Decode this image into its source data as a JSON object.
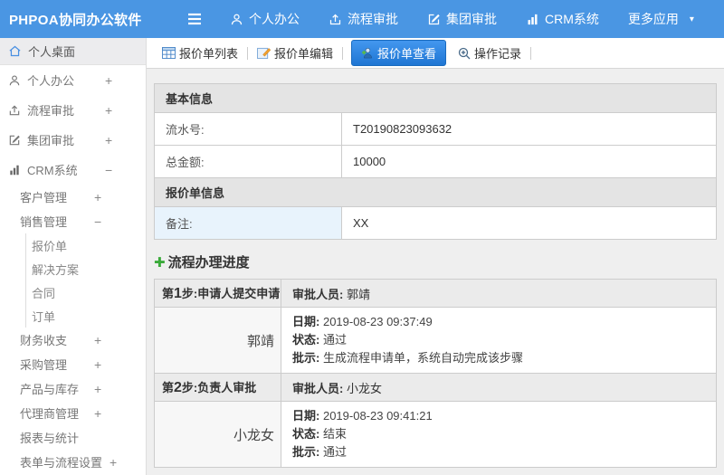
{
  "colors": {
    "navbar_blue": "#4a96e3",
    "active_tab_blue": "#2a80da",
    "page_bg": "#efefef",
    "section_header_bg": "#e4e4e4",
    "highlight_cell_bg": "#e8f3fc",
    "plus_green": "#3aaa3a"
  },
  "icons": {
    "caret_down": "▾",
    "progress_plus": "✚"
  },
  "navbar": {
    "brand": "PHPOA协同办公软件",
    "menu": [
      {
        "label": "个人办公",
        "icon": "user-icon"
      },
      {
        "label": "流程审批",
        "icon": "process-icon"
      },
      {
        "label": "集团审批",
        "icon": "edit-icon"
      },
      {
        "label": "CRM系统",
        "icon": "chart-icon"
      },
      {
        "label": "更多应用",
        "icon": "chevron-down-icon"
      }
    ]
  },
  "sidebar": {
    "items": [
      {
        "label": "个人桌面",
        "icon": "home-icon",
        "active": true
      },
      {
        "label": "个人办公",
        "icon": "user-icon",
        "expand": "+"
      },
      {
        "label": "流程审批",
        "icon": "process-icon",
        "expand": "+"
      },
      {
        "label": "集团审批",
        "icon": "edit-icon",
        "expand": "+"
      },
      {
        "label": "CRM系统",
        "icon": "chart-icon",
        "expand": "−"
      },
      {
        "label": "客户管理",
        "level": 1,
        "expand": "+"
      },
      {
        "label": "销售管理",
        "level": 1,
        "expand": "−"
      },
      {
        "label": "报价单",
        "level": 2
      },
      {
        "label": "解决方案",
        "level": 2
      },
      {
        "label": "合同",
        "level": 2
      },
      {
        "label": "订单",
        "level": 2
      },
      {
        "label": "财务收支",
        "level": 1,
        "expand": "+"
      },
      {
        "label": "采购管理",
        "level": 1,
        "expand": "+"
      },
      {
        "label": "产品与库存",
        "level": 1,
        "expand": "+"
      },
      {
        "label": "代理商管理",
        "level": 1,
        "expand": "+"
      },
      {
        "label": "报表与统计",
        "level": 1
      },
      {
        "label": "表单与流程设置",
        "level": 1,
        "expand": "+"
      }
    ]
  },
  "toolbar": {
    "tabs": [
      {
        "label": "报价单列表",
        "icon": "table-icon"
      },
      {
        "label": "报价单编辑",
        "icon": "edit-doc-icon"
      },
      {
        "label": "报价单查看",
        "icon": "view-icon",
        "active": true
      },
      {
        "label": "操作记录",
        "icon": "magnifier-icon"
      }
    ]
  },
  "form": {
    "sections": [
      {
        "header": "基本信息",
        "rows": [
          {
            "label": "流水号:",
            "value": "T20190823093632"
          },
          {
            "label": "总金额:",
            "value": "10000"
          }
        ]
      },
      {
        "header": "报价单信息",
        "rows": [
          {
            "label": "备注:",
            "value": "XX"
          }
        ]
      }
    ]
  },
  "progress": {
    "title": "流程办理进度",
    "steps": [
      {
        "step_prefix": "第",
        "step_num": "1",
        "step_suffix": "步:申请人提交申请",
        "approver_label": "审批人员:",
        "approver": "郭靖",
        "name": "郭靖",
        "rows": [
          {
            "label": "日期:",
            "value": "2019-08-23 09:37:49"
          },
          {
            "label": "状态:",
            "value": "通过"
          },
          {
            "label": "批示:",
            "value": "生成流程申请单，系统自动完成该步骤"
          }
        ]
      },
      {
        "step_prefix": "第",
        "step_num": "2",
        "step_suffix": "步:负责人审批",
        "approver_label": "审批人员:",
        "approver": "小龙女",
        "name": "小龙女",
        "rows": [
          {
            "label": "日期:",
            "value": "2019-08-23 09:41:21"
          },
          {
            "label": "状态:",
            "value": "结束"
          },
          {
            "label": "批示:",
            "value": "通过"
          }
        ]
      }
    ]
  }
}
